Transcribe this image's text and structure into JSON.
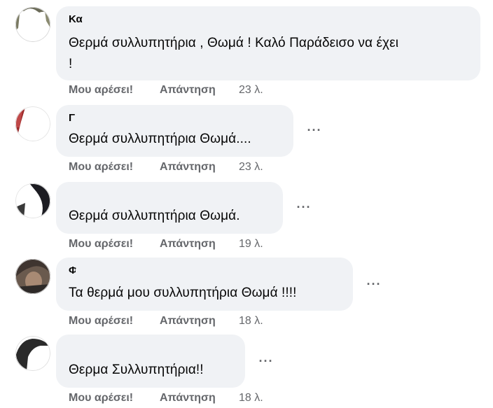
{
  "comments": [
    {
      "author": "Κα",
      "text_line1": "Θερμά συλλυπητήρια , Θωμά ! Καλό Παράδεισο να έχει",
      "text_line2": "!",
      "like_label": "Μου αρέσει!",
      "reply_label": "Απάντηση",
      "time": "23 λ."
    },
    {
      "author": "Γ",
      "text_line1": "Θερμά συλλυπητήρια Θωμά....",
      "like_label": "Μου αρέσει!",
      "reply_label": "Απάντηση",
      "time": "23 λ.",
      "more_label": "···"
    },
    {
      "author": "",
      "text_line1": "Θερμά συλλυπητήρια Θωμά.",
      "like_label": "Μου αρέσει!",
      "reply_label": "Απάντηση",
      "time": "19 λ.",
      "more_label": "···"
    },
    {
      "author": "Φ",
      "text_line1": "Τα θερμά μου συλλυπητήρια Θωμά !!!!",
      "like_label": "Μου αρέσει!",
      "reply_label": "Απάντηση",
      "time": "18 λ.",
      "more_label": "···"
    },
    {
      "author": "",
      "text_line1": "Θερμα Συλλυπητήρια!!",
      "like_label": "Μου αρέσει!",
      "reply_label": "Απάντηση",
      "time": "18 λ.",
      "more_label": "···"
    }
  ]
}
